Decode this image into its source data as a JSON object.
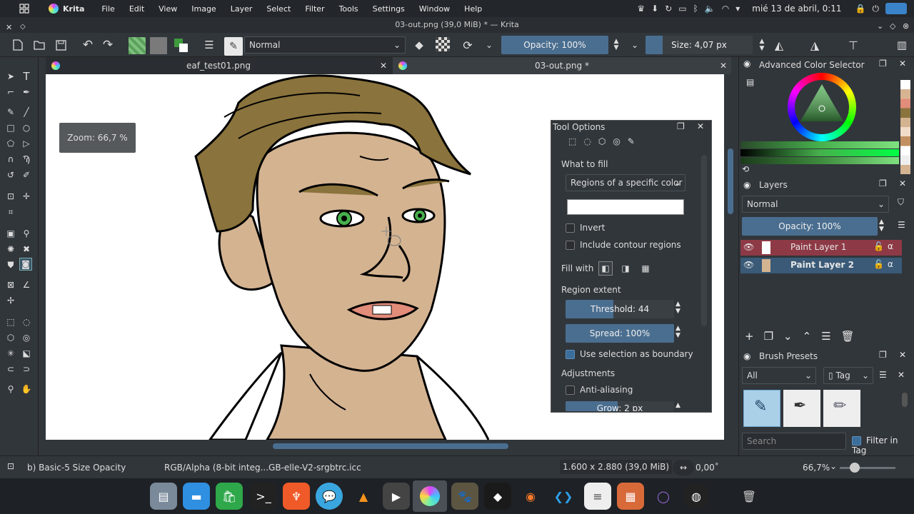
{
  "system": {
    "app_name": "Krita",
    "menu": [
      "File",
      "Edit",
      "View",
      "Image",
      "Layer",
      "Select",
      "Filter",
      "Tools",
      "Settings",
      "Window",
      "Help"
    ],
    "clock": "mié 13 de abril, 0:11"
  },
  "window": {
    "title": "03-out.png (39,0 MiB) * — Krita"
  },
  "toolbar": {
    "blend_mode": "Normal",
    "opacity": "Opacity: 100%",
    "size": "Size: 4,07 px"
  },
  "tabs": [
    {
      "label": "eaf_test01.png"
    },
    {
      "label": "03-out.png *"
    }
  ],
  "canvas": {
    "zoom_tip": "Zoom: 66,7 %"
  },
  "tool_options": {
    "title": "Tool Options",
    "what_to_fill_label": "What to fill",
    "what_to_fill_value": "Regions of a specific color",
    "invert": "Invert",
    "include_contour": "Include contour regions",
    "fill_with": "Fill with",
    "region_extent": "Region extent",
    "threshold": "Threshold: 44",
    "spread": "Spread: 100%",
    "use_selection": "Use selection as boundary",
    "adjustments": "Adjustments",
    "anti_aliasing": "Anti-aliasing",
    "grow": "Grow: 2 px"
  },
  "color_selector": {
    "title": "Advanced Color Selector"
  },
  "layers": {
    "title": "Layers",
    "blend_mode": "Normal",
    "opacity": "Opacity:  100%",
    "items": [
      {
        "name": "Paint Layer 1"
      },
      {
        "name": "Paint Layer 2"
      }
    ]
  },
  "brush_presets": {
    "title": "Brush Presets",
    "filter": "All",
    "tag": "Tag",
    "search_placeholder": "Search",
    "filter_in_tag": "Filter in Tag"
  },
  "status": {
    "brush": "b) Basic-5 Size Opacity",
    "color_space": "RGB/Alpha (8-bit integ...GB-elle-V2-srgbtrc.icc",
    "dimensions": "1.600 x 2.880 (39,0 MiB)",
    "rotation": "0,00˚",
    "zoom": "66,7%"
  },
  "colors": {
    "accent": "#4a6e90",
    "skin": "#d4b391",
    "hair": "#8a733c",
    "eyes": "#46b04c"
  }
}
